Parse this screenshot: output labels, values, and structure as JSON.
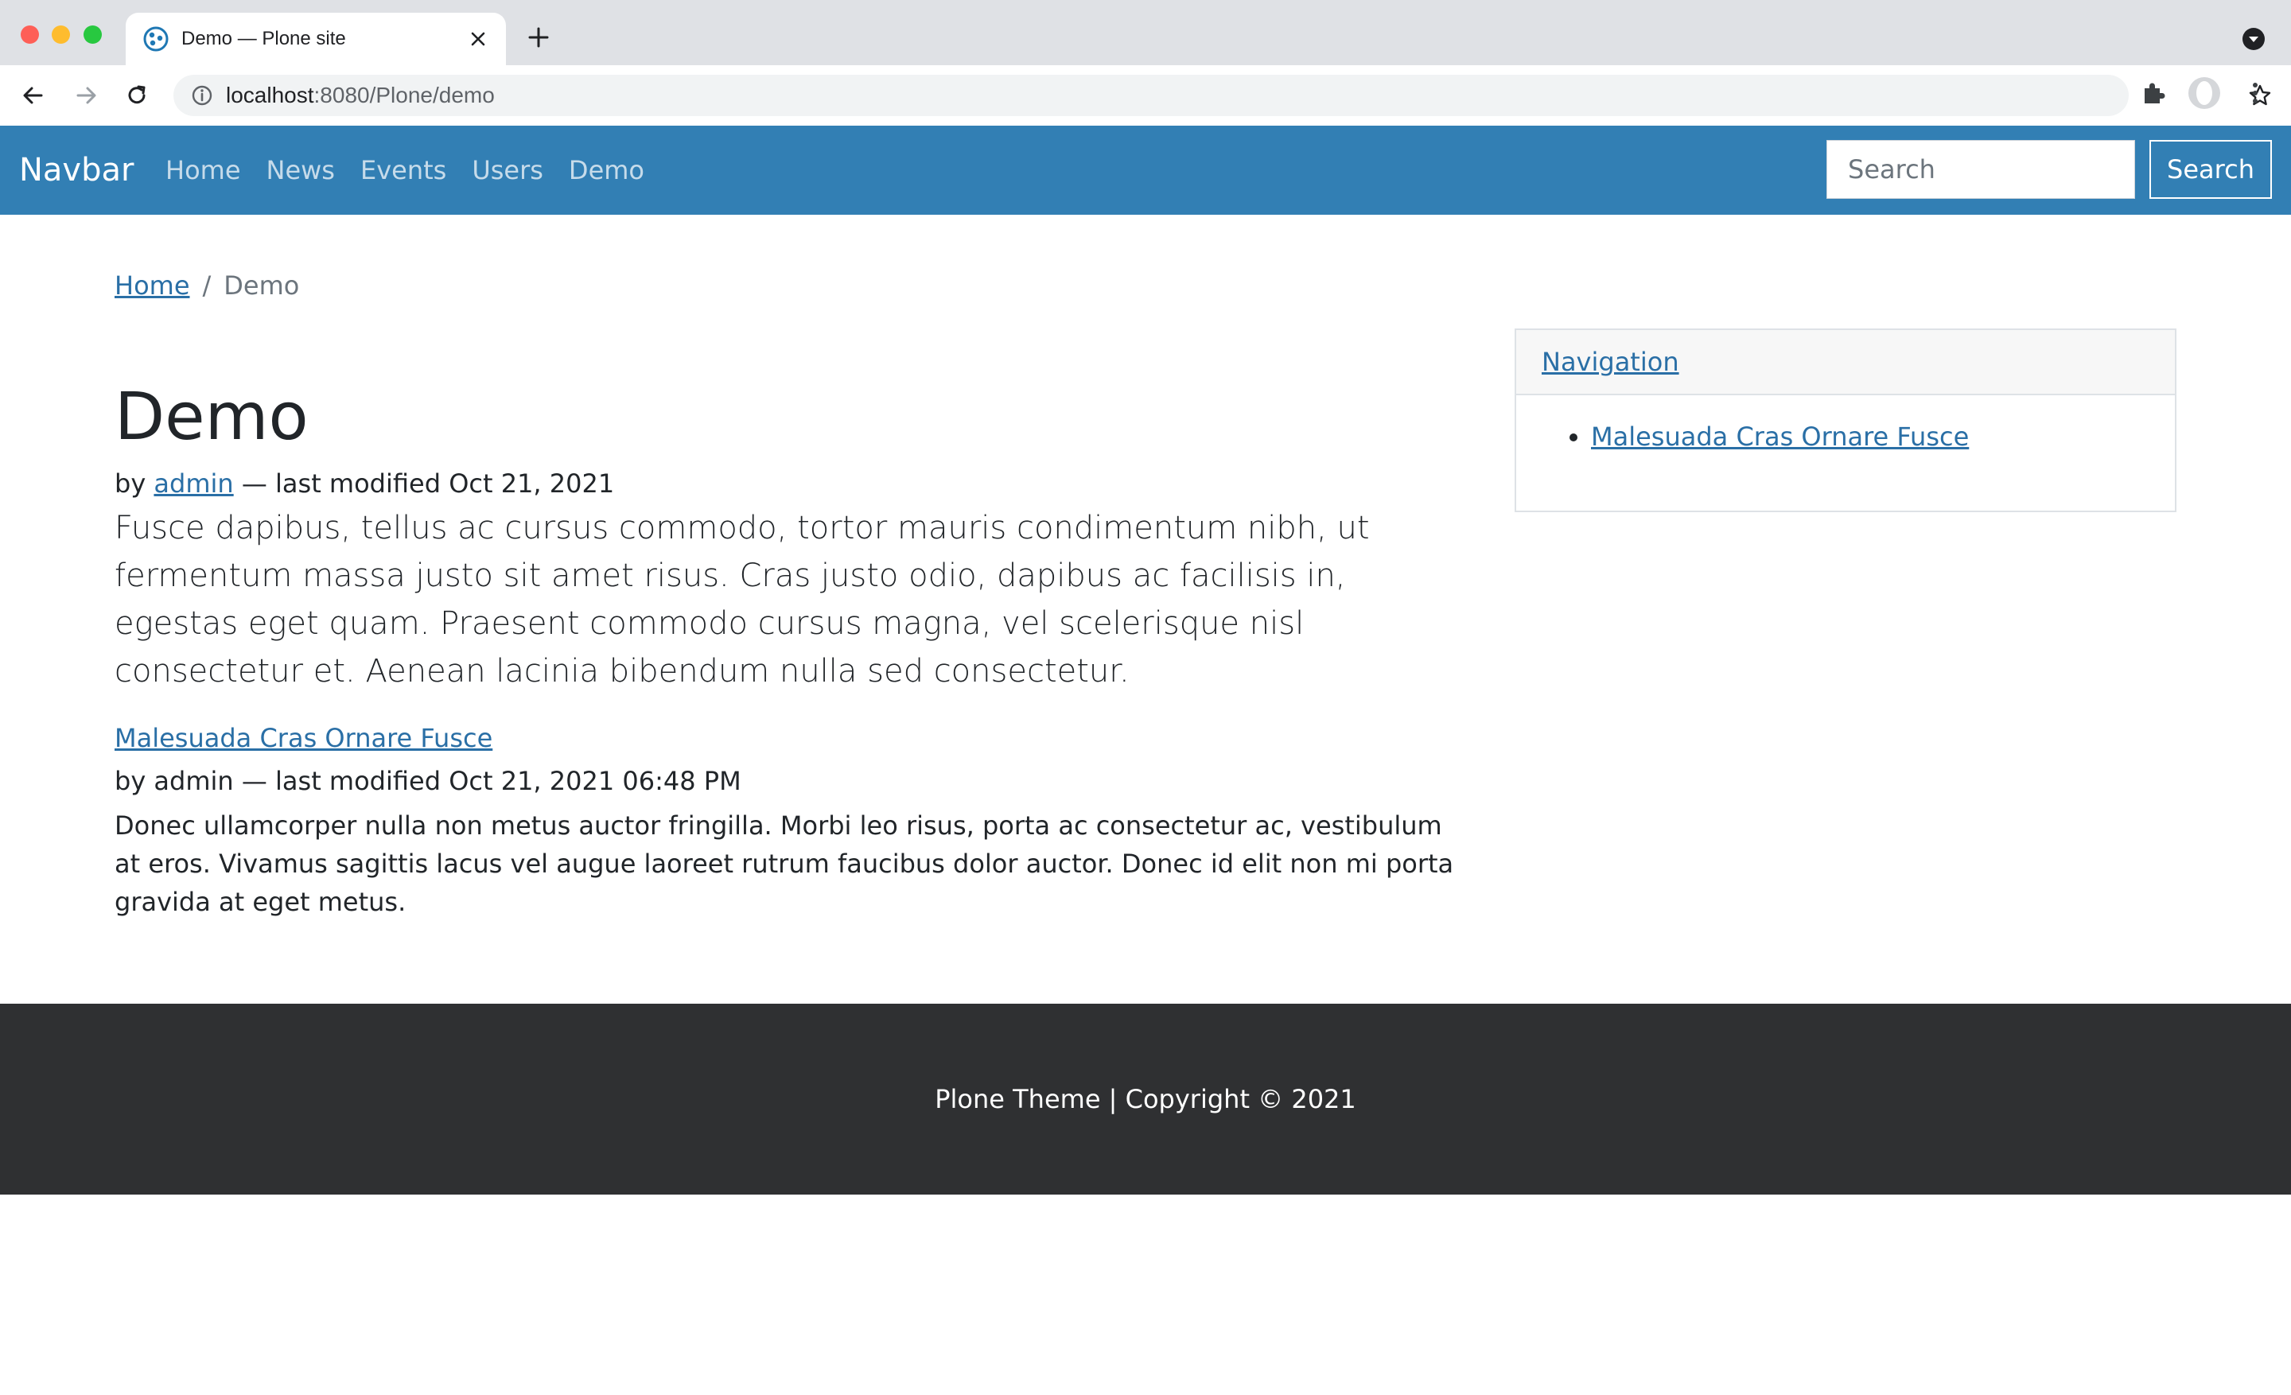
{
  "browser": {
    "tab_title": "Demo — Plone site",
    "url_host": "localhost",
    "url_path": ":8080/Plone/demo"
  },
  "navbar": {
    "brand": "Navbar",
    "links": [
      "Home",
      "News",
      "Events",
      "Users",
      "Demo"
    ],
    "search_placeholder": "Search",
    "search_button": "Search"
  },
  "breadcrumb": {
    "home": "Home",
    "separator": "/",
    "current": "Demo"
  },
  "page": {
    "title": "Demo",
    "by": "by",
    "author": "admin",
    "modified": " — last modified Oct 21, 2021",
    "description": "Fusce dapibus, tellus ac cursus commodo, tortor mauris condimentum nibh, ut fermentum massa justo sit amet risus. Cras justo odio, dapibus ac facilisis in, egestas eget quam. Praesent commodo cursus magna, vel scelerisque nisl consectetur et. Aenean lacinia bibendum nulla sed consectetur."
  },
  "item": {
    "title": "Malesuada Cras Ornare Fusce",
    "by": "by",
    "author": "admin",
    "modified": " — last modified Oct 21, 2021 06:48 PM",
    "description": "Donec ullamcorper nulla non metus auctor fringilla. Morbi leo risus, porta ac consectetur ac, vestibulum at eros. Vivamus sagittis lacus vel augue laoreet rutrum faucibus dolor auctor. Donec id elit non mi porta gravida at eget metus."
  },
  "portlet": {
    "title": "Navigation",
    "items": [
      "Malesuada Cras Ornare Fusce"
    ]
  },
  "footer": {
    "text": "Plone Theme | Copyright © 2021"
  },
  "colors": {
    "navbar": "#327fb4",
    "link": "#2a6fa6",
    "footer": "#2f3032"
  },
  "icons": [
    "plone-favicon-icon",
    "close-icon",
    "plus-icon",
    "chevron-down-icon",
    "back-arrow-icon",
    "forward-arrow-icon",
    "reload-icon",
    "info-icon",
    "star-icon",
    "puzzle-extension-icon",
    "profile-avatar-icon",
    "kebab-menu-icon"
  ]
}
